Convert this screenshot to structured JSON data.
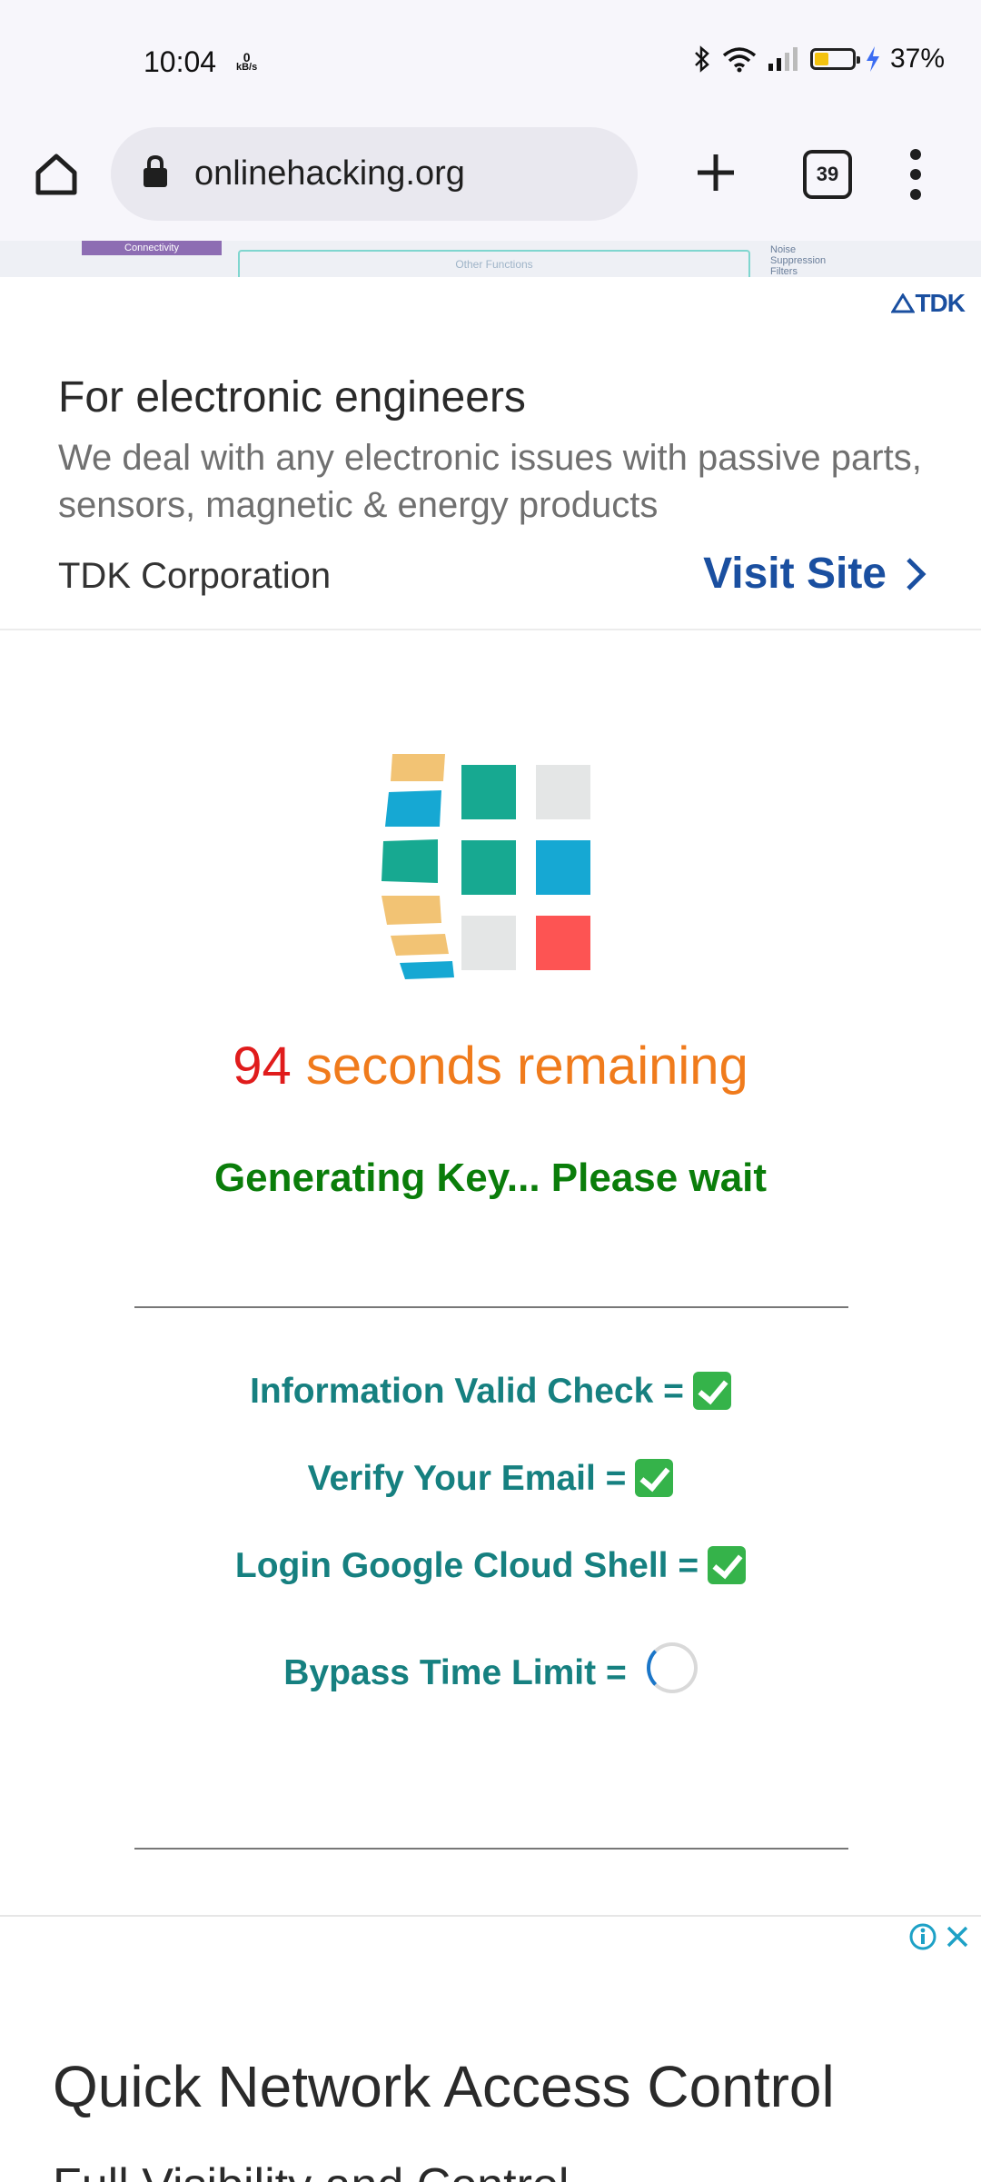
{
  "status_bar": {
    "time": "10:04",
    "net_speed_value": "0",
    "net_speed_unit": "kB/s",
    "battery_percent": "37%",
    "battery_level": 0.37,
    "icons": [
      "bluetooth-icon",
      "wifi-icon",
      "signal-icon",
      "battery-icon",
      "charging-icon"
    ]
  },
  "browser": {
    "url": "onlinehacking.org",
    "tab_count": "39",
    "icons": [
      "home-icon",
      "lock-icon",
      "plus-icon",
      "tabs-icon",
      "menu-icon"
    ]
  },
  "ad_top": {
    "brand_logo": "TDK",
    "title": "For electronic engineers",
    "description": "We deal with any electronic issues with passive parts, sensors, magnetic & energy products",
    "advertiser": "TDK Corporation",
    "cta": "Visit Site",
    "strip_labels": [
      "Connectivity",
      "Other Functions",
      "Noise Suppression Filters"
    ]
  },
  "main": {
    "countdown_number": "94",
    "countdown_text": "seconds remaining",
    "status_message": "Generating Key... Please wait",
    "checks": [
      {
        "label": "Information Valid Check =",
        "state": "done"
      },
      {
        "label": "Verify Your Email =",
        "state": "done"
      },
      {
        "label": "Login Google Cloud Shell =",
        "state": "done"
      },
      {
        "label": "Bypass Time Limit =",
        "state": "loading"
      }
    ],
    "colors": {
      "countdown_number": "#e01c1c",
      "countdown_text": "#f07b1c",
      "status": "#0a7d0a",
      "checks": "#168080"
    }
  },
  "ad_bottom": {
    "title": "Quick Network Access Control",
    "subtitle": "Full Visibility and Control"
  }
}
